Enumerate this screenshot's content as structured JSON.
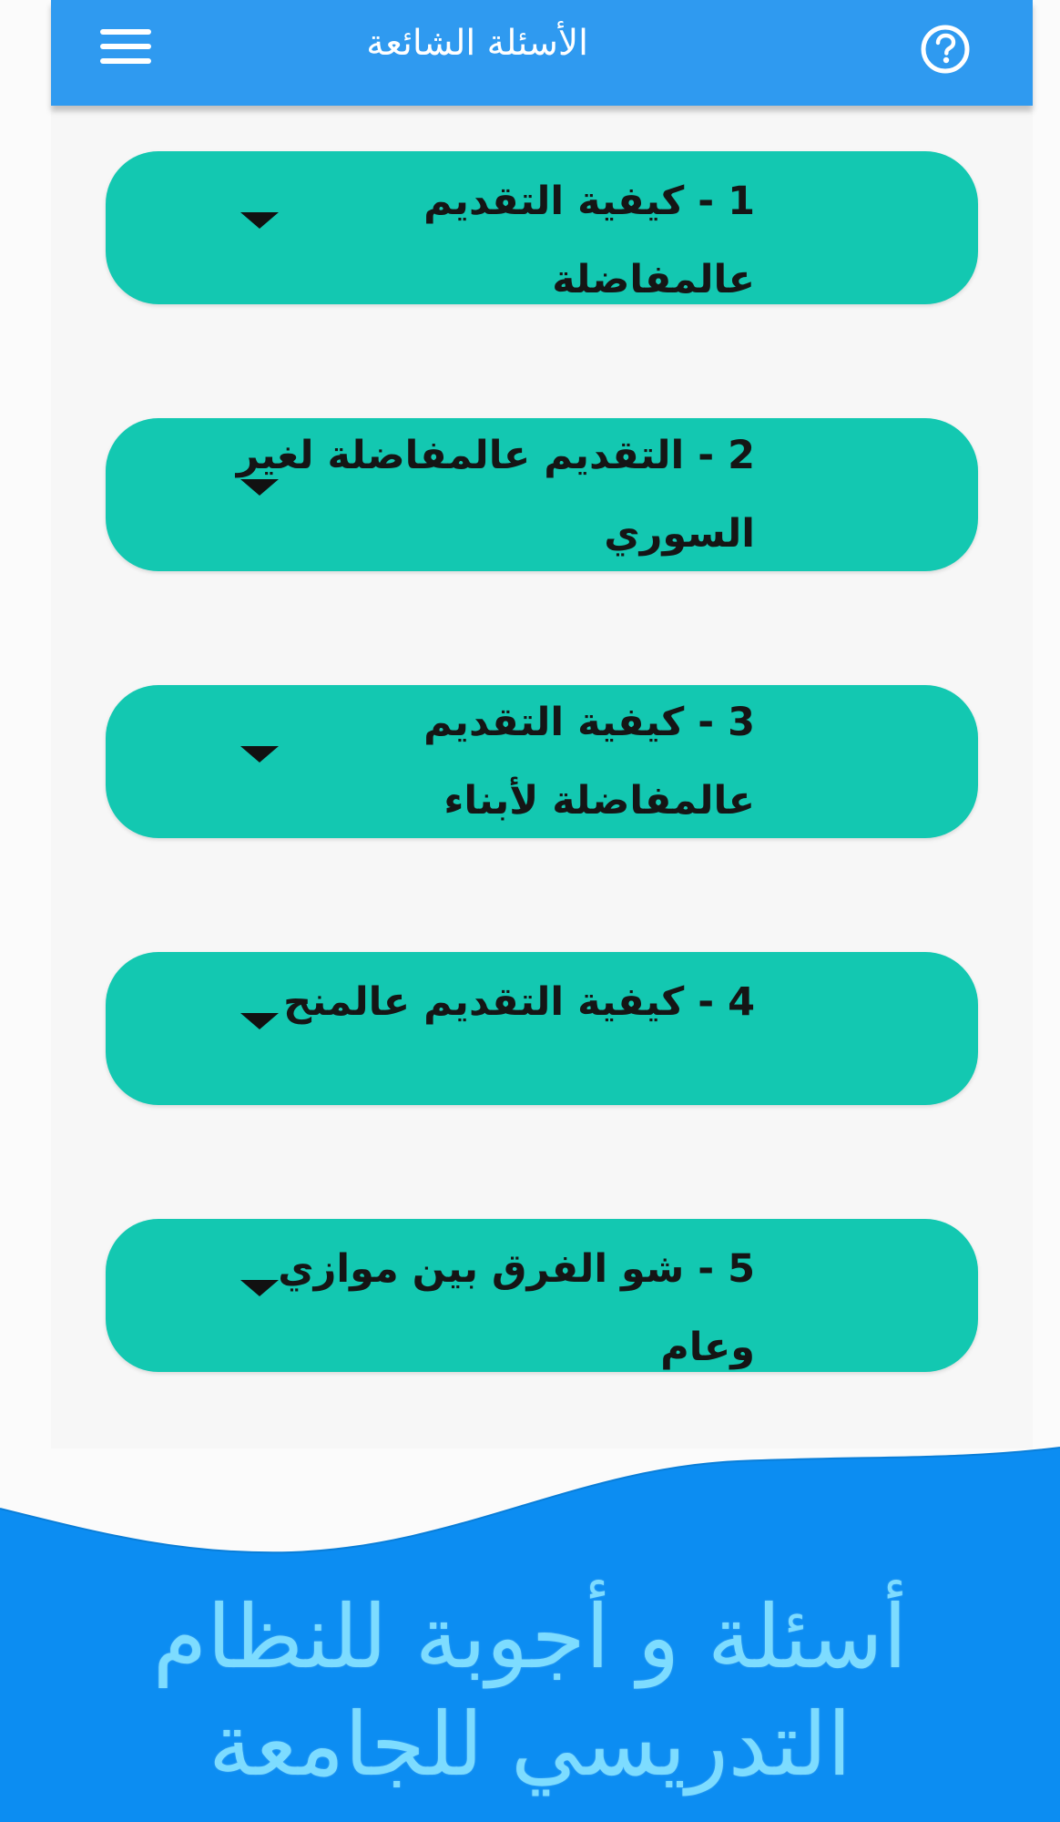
{
  "app_bar": {
    "title": "الأسئلة الشائعة",
    "menu_icon": "hamburger-menu-icon",
    "help_icon": "question-circle-icon",
    "background_color": "#2f9af0",
    "text_color": "#ffffff"
  },
  "faq": {
    "item_color": "#13c8b1",
    "expand_icon": "caret-down-icon",
    "items": [
      {
        "label": "1 - كيفية التقديم عالمفاضلة"
      },
      {
        "label": "2 -  التقديم عالمفاضلة لغير السوري"
      },
      {
        "label": "3 - كيفية التقديم عالمفاضلة لأبناء"
      },
      {
        "label": "4 - كيفية التقديم عالمنح"
      },
      {
        "label": "5 - شو الفرق بين موازي وعام"
      }
    ]
  },
  "banner": {
    "line_1": "أسئلة و أجوبة للنظام",
    "line_2": "التدريسي للجامعة",
    "background_color": "#0c8df2",
    "text_color": "#7ddcff"
  }
}
